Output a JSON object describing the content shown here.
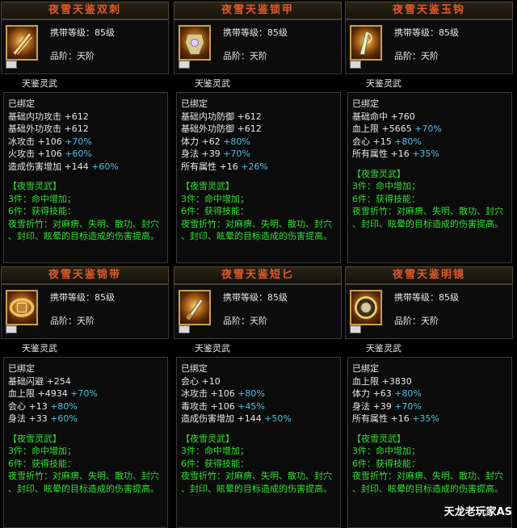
{
  "cards": [
    {
      "title": "夜雪天鉴双刺",
      "icon": "dual-dagger-icon",
      "level": "携带等级：85级",
      "grade": "品阶：天阶",
      "sub": "天鉴灵武",
      "bound": "已绑定",
      "stats": [
        {
          "name": "基础内功攻击",
          "val": "+612",
          "pct": ""
        },
        {
          "name": "基础外功攻击",
          "val": "+612",
          "pct": ""
        },
        {
          "name": "冰攻击",
          "val": "+106",
          "pct": "+70%"
        },
        {
          "name": "火攻击",
          "val": "+106",
          "pct": "+60%"
        },
        {
          "name": "造成伤害增加",
          "val": "+144",
          "pct": "+60%"
        }
      ]
    },
    {
      "title": "夜雪天鉴锁甲",
      "icon": "armor-icon",
      "level": "携带等级：85级",
      "grade": "品阶：天阶",
      "sub": "天鉴灵武",
      "bound": "已绑定",
      "stats": [
        {
          "name": "基础内功防御",
          "val": "+612",
          "pct": ""
        },
        {
          "name": "基础外功防御",
          "val": "+612",
          "pct": ""
        },
        {
          "name": "体力",
          "val": "+62",
          "pct": "+80%"
        },
        {
          "name": "身法",
          "val": "+39",
          "pct": "+70%"
        },
        {
          "name": "所有属性",
          "val": "+16",
          "pct": "+26%"
        }
      ]
    },
    {
      "title": "夜雪天鉴玉钩",
      "icon": "jade-hook-icon",
      "level": "携带等级：85级",
      "grade": "品阶：天阶",
      "sub": "天鉴灵武",
      "bound": "已绑定",
      "stats": [
        {
          "name": "基础命中",
          "val": "+760",
          "pct": ""
        },
        {
          "name": "血上限",
          "val": "+5665",
          "pct": "+70%"
        },
        {
          "name": "会心",
          "val": "+15",
          "pct": "+80%"
        },
        {
          "name": "所有属性",
          "val": "+16",
          "pct": "+35%"
        }
      ]
    },
    {
      "title": "夜雪天鉴锦带",
      "icon": "belt-icon",
      "level": "携带等级：85级",
      "grade": "品阶：天阶",
      "sub": "天鉴灵武",
      "bound": "已绑定",
      "stats": [
        {
          "name": "基础闪避",
          "val": "+254",
          "pct": ""
        },
        {
          "name": "血上限",
          "val": "+4934",
          "pct": "+70%"
        },
        {
          "name": "会心",
          "val": "+13",
          "pct": "+80%"
        },
        {
          "name": "身法",
          "val": "+33",
          "pct": "+60%"
        }
      ]
    },
    {
      "title": "夜雪天鉴短匕",
      "icon": "short-dagger-icon",
      "level": "携带等级：85级",
      "grade": "品阶：天阶",
      "sub": "天鉴灵武",
      "bound": "已绑定",
      "stats": [
        {
          "name": "会心",
          "val": "+10",
          "pct": ""
        },
        {
          "name": "冰攻击",
          "val": "+106",
          "pct": "+80%"
        },
        {
          "name": "毒攻击",
          "val": "+106",
          "pct": "+45%"
        },
        {
          "name": "造成伤害增加",
          "val": "+144",
          "pct": "+50%"
        }
      ]
    },
    {
      "title": "夜雪天鉴明镜",
      "icon": "mirror-icon",
      "level": "携带等级：85级",
      "grade": "品阶：天阶",
      "sub": "天鉴灵武",
      "bound": "已绑定",
      "stats": [
        {
          "name": "血上限",
          "val": "+3830",
          "pct": ""
        },
        {
          "name": "体力",
          "val": "+63",
          "pct": "+80%"
        },
        {
          "name": "身法",
          "val": "+39",
          "pct": "+70%"
        },
        {
          "name": "所有属性",
          "val": "+16",
          "pct": "+35%"
        }
      ]
    }
  ],
  "set_bonus": {
    "name": "【夜雪灵武】",
    "piece3": "3件：命中增加；",
    "piece6": "6件：获得技能：",
    "skill_line1": "夜雪折竹：对麻痹、失明、散功、封穴",
    "skill_line2": "、封印、眩晕的目标造成的伤害提高。"
  },
  "watermark": "天龙老玩家AS",
  "colors": {
    "title": "#e05a2a",
    "set_green": "#30e030",
    "percent_blue": "#4ec0e8"
  }
}
